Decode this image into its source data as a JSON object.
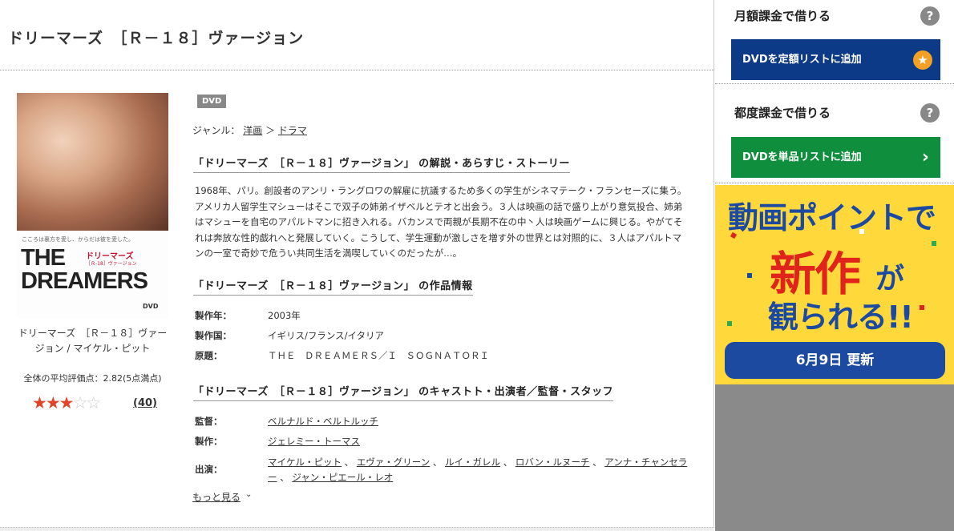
{
  "page": {
    "title": "ドリーマーズ　［Ｒ－１８］ヴァージョン"
  },
  "poster": {
    "tagline": "こころは裏方を愛し、からだは彼を愛した。",
    "jp_title": "ドリーマーズ",
    "jp_sub": "［Ｒ-18］ヴァージョン",
    "title_line1": "THE",
    "title_line2": "DREAMERS",
    "logo": "DVD",
    "caption": "ドリーマーズ　［Ｒ－１８］ヴァージョン / マイケル・ピット"
  },
  "rating": {
    "text": "全体の平均評価点：2.82(5点満点)",
    "value": 2.82,
    "stars_filled": 3,
    "stars_total": 5,
    "count": "(40)"
  },
  "detail": {
    "badge": "DVD",
    "genre_label": "ジャンル：",
    "genre_parent": "洋画",
    "genre_sep": "＞",
    "genre_child": "ドラマ",
    "synopsis_title": "「ドリーマーズ　［Ｒ－１８］ヴァージョン」 の解説・あらすじ・ストーリー",
    "synopsis": "1968年、パリ。創設者のアンリ・ラングロワの解雇に抗議するため多くの学生がシネマテーク・フランセーズに集う。アメリカ人留学生マシューはそこで双子の姉弟イザベルとテオと出会う。３人は映画の話で盛り上がり意気投合、姉弟はマシューを自宅のアパルトマンに招き入れる。バカンスで両親が長期不在の中丶人は映画ゲームに興じる。やがてそれは奔放な性的戯れへと発展していく。こうして、学生運動が激しさを増す外の世界とは対照的に、３人はアパルトマンの一室で奇妙で危うい共同生活を満喫していくのだったが…。",
    "info_title": "「ドリーマーズ　［Ｒ－１８］ヴァージョン」 の作品情報",
    "info": {
      "year_label": "製作年：",
      "year": "2003年",
      "country_label": "製作国：",
      "country": "イギリス/フランス/イタリア",
      "original_label": "原題：",
      "original": "ＴＨＥ　ＤＲＥＡＭＥＲＳ／Ｉ　ＳＯＧＮＡＴＯＲＩ"
    },
    "cast_title": "「ドリーマーズ　［Ｒ－１８］ヴァージョン」 のキャストト・出演者／監督・スタッフ",
    "cast": {
      "director_label": "監督：",
      "director": "ベルナルド・ベルトルッチ",
      "producer_label": "製作：",
      "producer": "ジェレミー・トーマス",
      "actors_label": "出演：",
      "actors": [
        "マイケル・ピット",
        "エヴァ・グリーン",
        "ルイ・ガレル",
        "ロバン・ルヌーチ",
        "アンナ・チャンセラー",
        "ジャン・ピエール・レオ"
      ]
    },
    "more_label": "もっと見る"
  },
  "sidebar": {
    "monthly_title": "月額課金で借りる",
    "monthly_button": "DVDを定額リストに追加",
    "single_title": "都度課金で借りる",
    "single_button": "DVDを単品リストに追加",
    "help": "?"
  },
  "banner": {
    "line1": "動画ポイントで",
    "line2": "新作",
    "line2b": "が",
    "line3": "観られる!!",
    "update": "6月9日 更新"
  },
  "colors": {
    "monthly_button": "#0d3a86",
    "single_button": "#0f8f3e",
    "star_on": "#e0452a",
    "banner_bg": "#ffd93b",
    "banner_blue": "#1c4aa0",
    "banner_red": "#e0241c"
  },
  "icons": [
    "help-icon",
    "star-icon",
    "chevron-right-icon",
    "chevron-down-icon",
    "rating-star-icon"
  ]
}
